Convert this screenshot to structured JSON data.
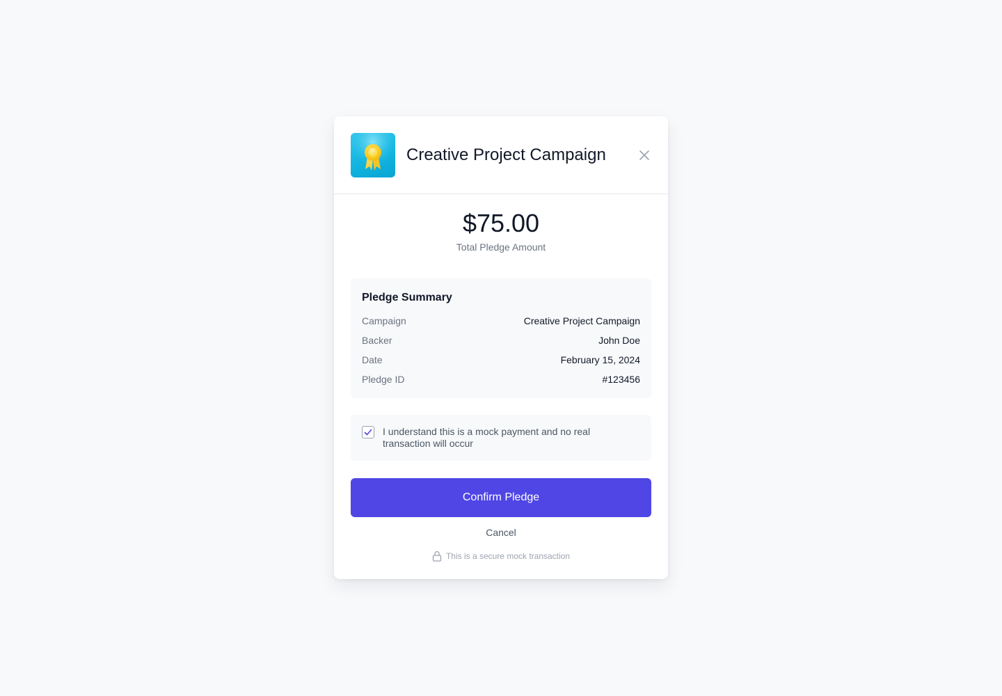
{
  "modal": {
    "title": "Creative Project Campaign",
    "logo_icon": "award-ribbon-icon",
    "close_icon": "close-icon"
  },
  "pledge": {
    "amount": "$75.00",
    "amount_label": "Total Pledge Amount"
  },
  "summary": {
    "title": "Pledge Summary",
    "rows": [
      {
        "label": "Campaign",
        "value": "Creative Project Campaign"
      },
      {
        "label": "Backer",
        "value": "John Doe"
      },
      {
        "label": "Date",
        "value": "February 15, 2024"
      },
      {
        "label": "Pledge ID",
        "value": "#123456"
      }
    ]
  },
  "consent": {
    "checked": true,
    "text": "I understand this is a mock payment and no real transaction will occur"
  },
  "actions": {
    "confirm_label": "Confirm Pledge",
    "cancel_label": "Cancel"
  },
  "footer": {
    "secure_text": "This is a secure mock transaction",
    "lock_icon": "lock-icon"
  },
  "colors": {
    "accent": "#4f46e5",
    "logo_bg": "#12b4e0",
    "medal": "#fbd43a"
  }
}
